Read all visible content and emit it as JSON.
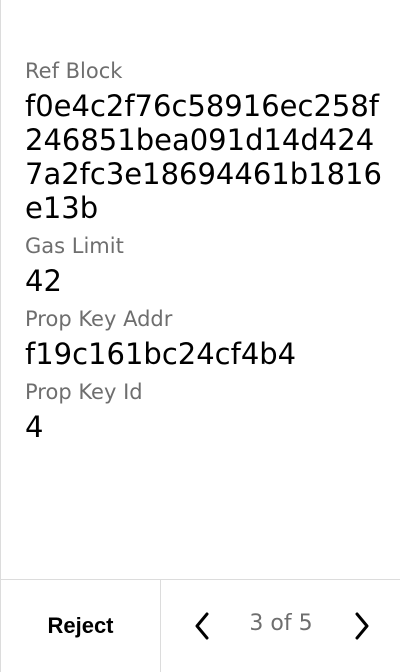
{
  "fields": [
    {
      "label": "Ref Block",
      "value": "f0e4c2f76c58916ec258f246851bea091d14d4247a2fc3e18694461b1816e13b"
    },
    {
      "label": "Gas Limit",
      "value": "42"
    },
    {
      "label": "Prop Key Addr",
      "value": "f19c161bc24cf4b4"
    },
    {
      "label": "Prop Key Id",
      "value": "4"
    }
  ],
  "footer": {
    "reject_label": "Reject",
    "page_indicator": "3 of 5",
    "prev_icon": "chevron-left-icon",
    "next_icon": "chevron-right-icon"
  }
}
